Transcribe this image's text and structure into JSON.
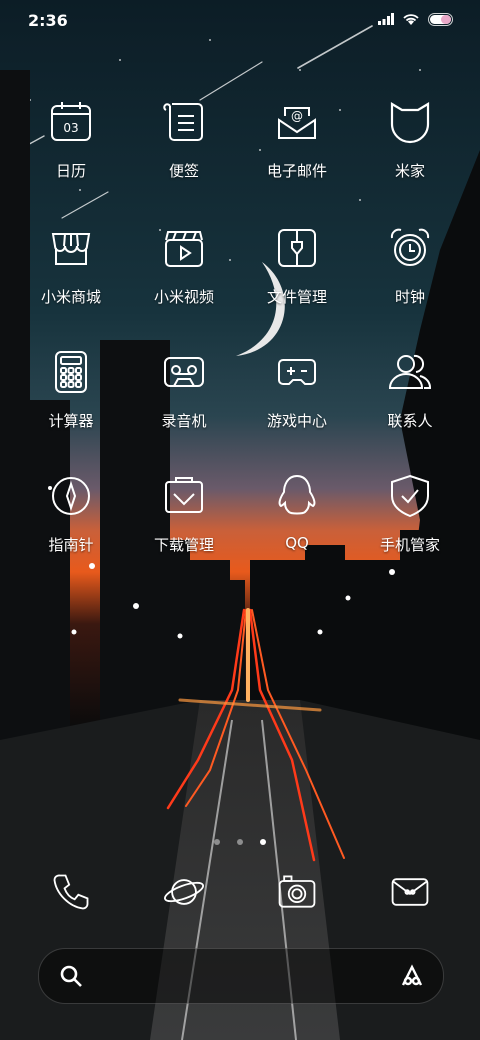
{
  "status": {
    "time": "2:36"
  },
  "apps": [
    {
      "label": "日历",
      "icon": "calendar-icon",
      "date": "03"
    },
    {
      "label": "便签",
      "icon": "notes-icon"
    },
    {
      "label": "电子邮件",
      "icon": "email-icon",
      "at": "@"
    },
    {
      "label": "米家",
      "icon": "mijia-cat-icon"
    },
    {
      "label": "小米商城",
      "icon": "store-icon"
    },
    {
      "label": "小米视频",
      "icon": "video-icon"
    },
    {
      "label": "文件管理",
      "icon": "file-manager-icon"
    },
    {
      "label": "时钟",
      "icon": "alarm-clock-icon"
    },
    {
      "label": "计算器",
      "icon": "calculator-icon"
    },
    {
      "label": "录音机",
      "icon": "recorder-icon"
    },
    {
      "label": "游戏中心",
      "icon": "gamepad-icon"
    },
    {
      "label": "联系人",
      "icon": "contacts-icon"
    },
    {
      "label": "指南针",
      "icon": "compass-icon"
    },
    {
      "label": "下载管理",
      "icon": "download-icon"
    },
    {
      "label": "QQ",
      "icon": "qq-penguin-icon"
    },
    {
      "label": "手机管家",
      "icon": "shield-icon"
    }
  ],
  "dock": [
    {
      "icon": "phone-icon"
    },
    {
      "icon": "planet-browser-icon"
    },
    {
      "icon": "camera-icon"
    },
    {
      "icon": "messages-icon"
    }
  ],
  "page_indicator": {
    "pages": 3,
    "current": 3
  },
  "search": {
    "icon": "search-icon",
    "assistant_icon": "assistant-icon"
  }
}
